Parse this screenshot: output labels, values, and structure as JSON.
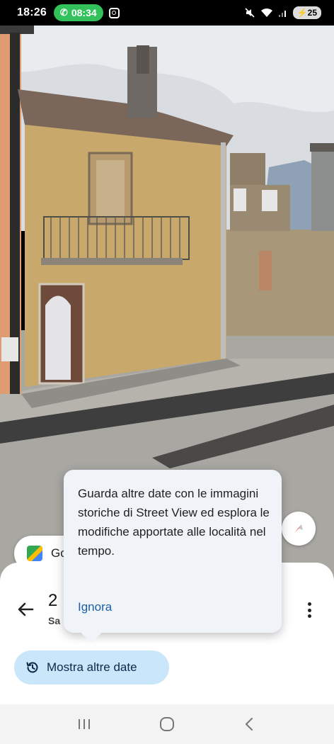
{
  "status_bar": {
    "time": "18:26",
    "call_timer": "08:34",
    "battery": "25"
  },
  "street_view": {
    "maps_chip_label": "Go"
  },
  "tooltip": {
    "text": "Guarda altre date con le immagini storiche di Street View ed esplora le modifiche apportate alle località nel tempo.",
    "dismiss_label": "Ignora"
  },
  "sheet": {
    "title": "2",
    "subtitle": "Sa",
    "more_dates_label": "Mostra altre date"
  },
  "colors": {
    "accent_button": "#c9e6fb",
    "link": "#1a5fa6",
    "call_pill": "#33c15b"
  },
  "icons": [
    "phone-icon",
    "instagram-icon",
    "mute-icon",
    "wifi-icon",
    "signal-icon",
    "back-arrow-icon",
    "more-vert-icon",
    "history-icon",
    "compass-icon",
    "google-maps-icon",
    "recents-icon",
    "home-icon",
    "nav-back-icon"
  ]
}
